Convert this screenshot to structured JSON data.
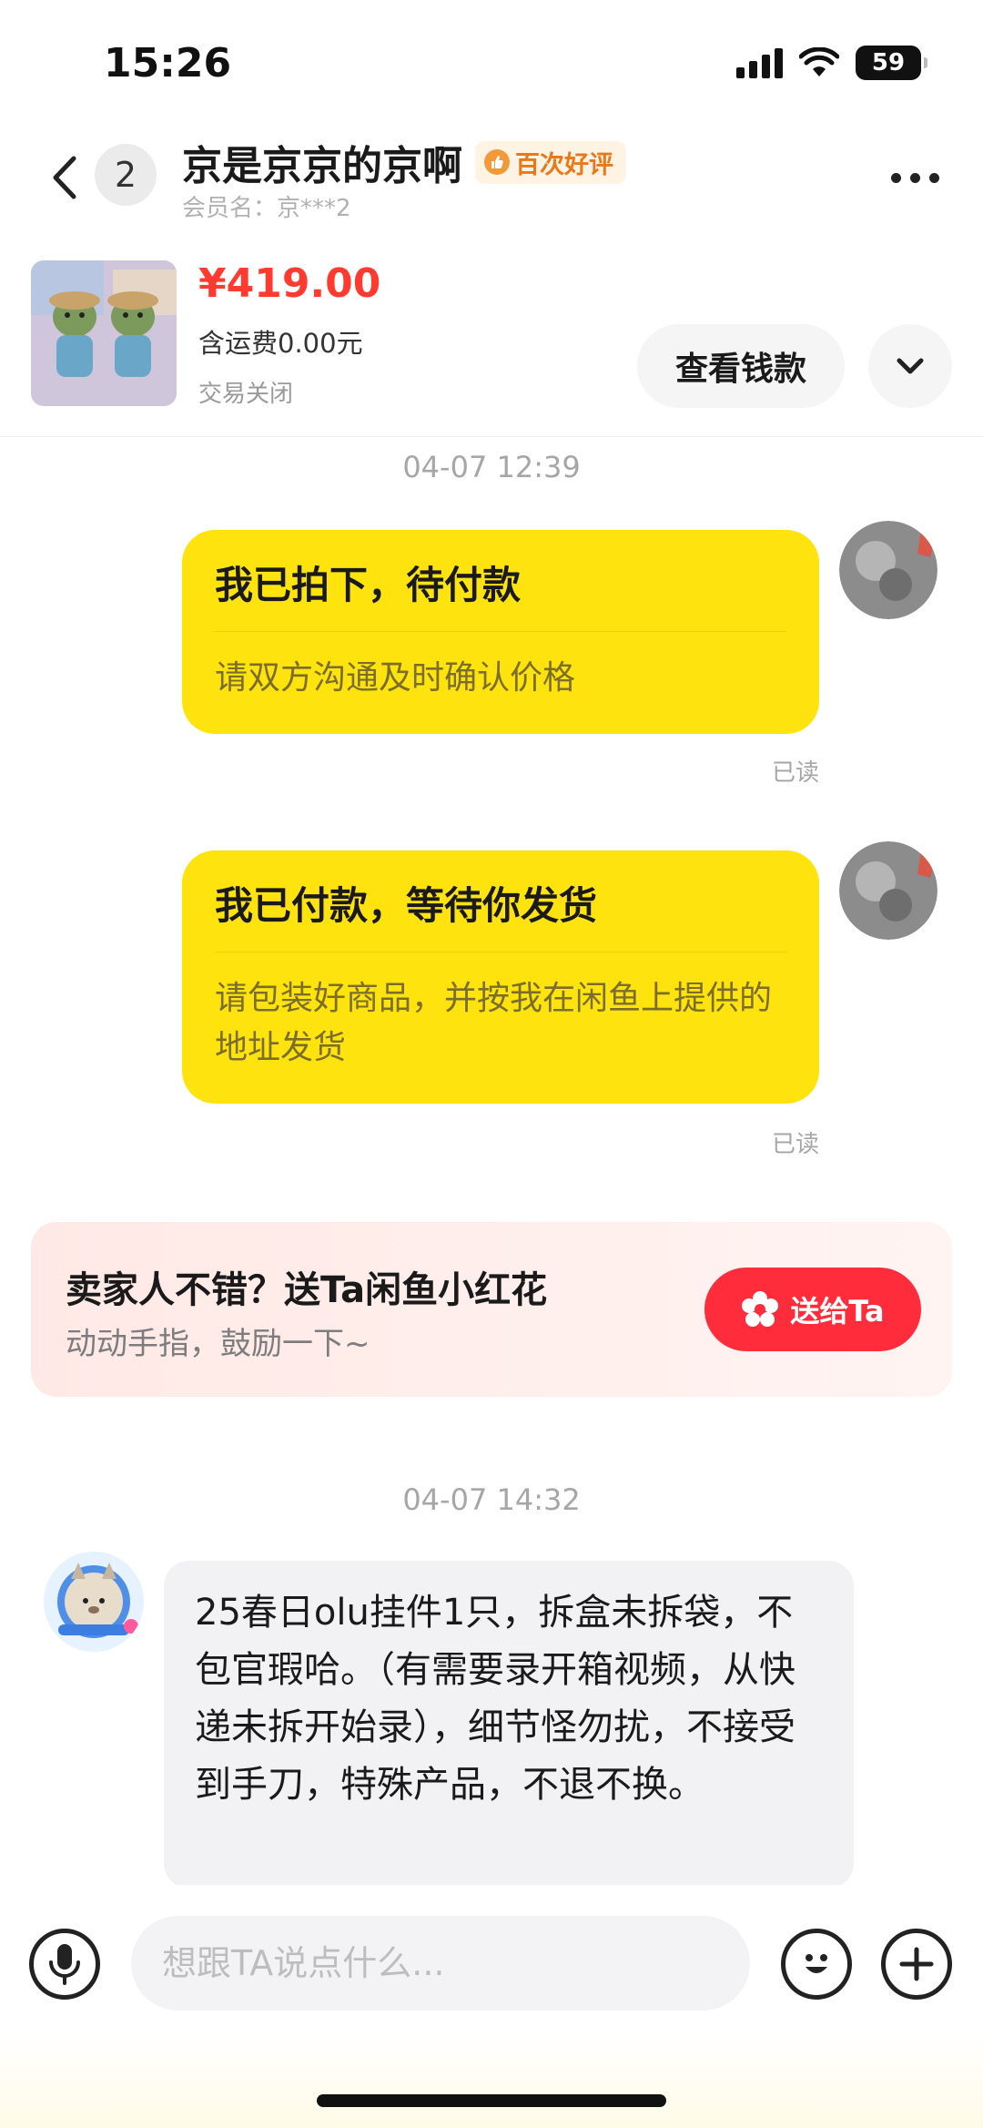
{
  "status_bar": {
    "time": "15:26",
    "battery": "59"
  },
  "header": {
    "unread_count": "2",
    "title": "京是京京的京啊",
    "badge": "百次好评",
    "member_label": "会员名：京***2"
  },
  "product": {
    "price": "¥419.00",
    "shipping": "含运费0.00元",
    "status": "交易关闭",
    "view_money_label": "查看钱款"
  },
  "messages": [
    {
      "timestamp": "04-07 12:39",
      "title": "我已拍下，待付款",
      "body": "请双方沟通及时确认价格",
      "read": "已读"
    },
    {
      "title": "我已付款，等待你发货",
      "body": "请包装好商品，并按我在闲鱼上提供的地址发货",
      "read": "已读"
    }
  ],
  "flower_card": {
    "title": "卖家人不错？送Ta闲鱼小红花",
    "subtitle": "动动手指，鼓励一下~",
    "button_label": "送给Ta"
  },
  "incoming": {
    "timestamp": "04-07 14:32",
    "text": "25春日olu挂件1只，拆盒未拆袋，不包官瑕哈。（有需要录开箱视频，从快递未拆开始录），细节怪勿扰，不接受到手刀，特殊产品，不退不换。"
  },
  "input": {
    "placeholder": "想跟TA说点什么..."
  },
  "icons": {
    "back": "chevron-left-icon",
    "more": "more-dots-icon",
    "expand": "chevron-down-icon",
    "mic": "microphone-icon",
    "emoji": "emoji-icon",
    "plus": "plus-icon",
    "flower": "flower-icon"
  },
  "colors": {
    "accent_yellow": "#ffe30f",
    "price_red": "#ff3b30",
    "send_red": "#ff2d3b",
    "badge_orange": "#e8781a"
  }
}
